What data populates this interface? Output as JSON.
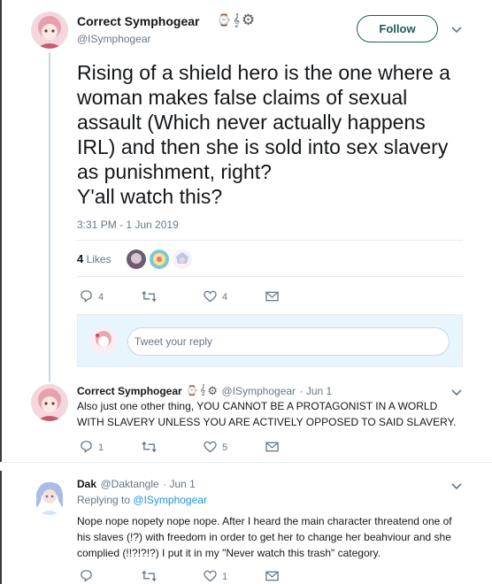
{
  "main_tweet": {
    "name": "Correct Symphogear",
    "handle": "@ISymphogear",
    "follow_label": "Follow",
    "text": "Rising of a shield hero is the one where a\nwoman makes false claims of sexual\nassault (Which never actually happens\nIRL) and then she is sold into sex slavery\nas punishment, right?\nY'all watch this?",
    "timestamp": "3:31 PM - 1 Jun 2019",
    "likes_count": "4",
    "likes_label": "Likes",
    "actions": {
      "reply": "4",
      "retweet": "",
      "like": "4"
    }
  },
  "reply_box": {
    "placeholder": "Tweet your reply"
  },
  "replies": [
    {
      "name": "Correct Symphogear",
      "handle": "@ISymphogear",
      "date": "· Jun 1",
      "text": "Also just one other thing, YOU CANNOT BE A PROTAGONIST IN A WORLD WITH SLAVERY UNLESS YOU ARE ACTIVELY OPPOSED TO SAID SLAVERY.",
      "actions": {
        "reply": "1",
        "retweet": "",
        "like": "5"
      }
    },
    {
      "name": "Dak",
      "handle": "@Daktangle",
      "date": "· Jun 1",
      "replying_prefix": "Replying to",
      "replying_to": "@ISymphogear",
      "text": "Nope nope nopety nope nope. After I heard the main character threatend one of his slaves (!?) with freedom in order to get her to change her beahviour and she complied (!!?!?!?) I put it in my \"Never watch this trash\" category.",
      "actions": {
        "reply": "",
        "retweet": "",
        "like": "1"
      }
    }
  ],
  "colors": {
    "accent": "#1d5c57",
    "link": "#1b95e0",
    "muted": "#657786",
    "reply_bg": "#e8f5fd"
  }
}
